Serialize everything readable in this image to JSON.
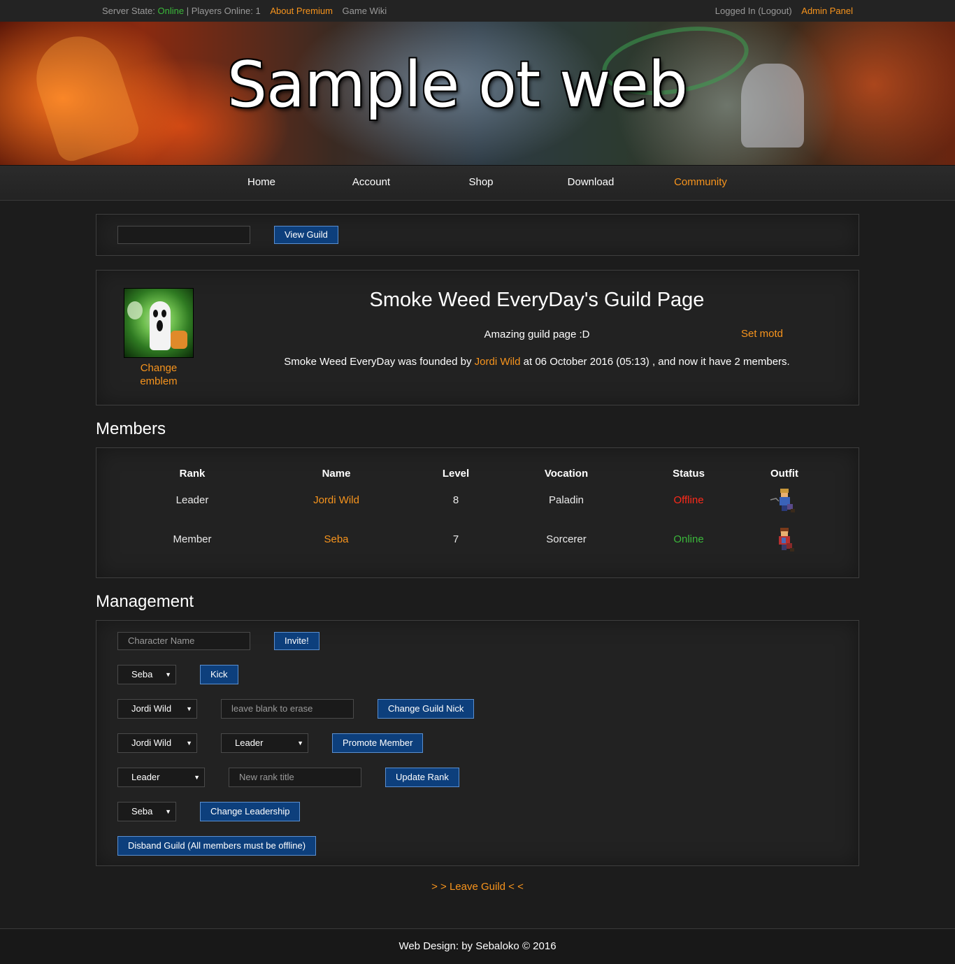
{
  "topbar": {
    "server_state_label": "Server State:",
    "server_state_value": "Online",
    "players_online": "| Players Online: 1",
    "about_premium": "About Premium",
    "game_wiki": "Game Wiki",
    "logged_in": "Logged In (Logout)",
    "admin_panel": "Admin Panel"
  },
  "banner": {
    "title": "Sample ot web"
  },
  "nav": {
    "items": [
      {
        "label": "Home"
      },
      {
        "label": "Account"
      },
      {
        "label": "Shop"
      },
      {
        "label": "Download"
      },
      {
        "label": "Community"
      }
    ],
    "active": "Community"
  },
  "view_guild": {
    "input_value": "",
    "button": "View Guild"
  },
  "guild": {
    "title": "Smoke Weed EveryDay's Guild Page",
    "change_emblem": "Change emblem",
    "motd": "Amazing guild page :D",
    "set_motd": "Set motd",
    "founded_prefix": "Smoke Weed EveryDay was founded by ",
    "founder": "Jordi Wild",
    "founded_suffix": " at 06 October 2016 (05:13) , and now it have 2 members."
  },
  "members": {
    "title": "Members",
    "headers": [
      "Rank",
      "Name",
      "Level",
      "Vocation",
      "Status",
      "Outfit"
    ],
    "rows": [
      {
        "rank": "Leader",
        "name": "Jordi Wild",
        "level": "8",
        "vocation": "Paladin",
        "status": "Offline"
      },
      {
        "rank": "Member",
        "name": "Seba",
        "level": "7",
        "vocation": "Sorcerer",
        "status": "Online"
      }
    ]
  },
  "management": {
    "title": "Management",
    "invite": {
      "placeholder": "Character Name",
      "button": "Invite!"
    },
    "kick": {
      "select": "Seba",
      "button": "Kick"
    },
    "nick": {
      "select": "Jordi Wild",
      "placeholder": "leave blank to erase",
      "button": "Change Guild Nick"
    },
    "promote": {
      "select_member": "Jordi Wild",
      "select_rank": "Leader",
      "button": "Promote Member"
    },
    "rank": {
      "select": "Leader",
      "placeholder": "New rank title",
      "button": "Update Rank"
    },
    "leadership": {
      "select": "Seba",
      "button": "Change Leadership"
    },
    "disband": {
      "button": "Disband Guild (All members must be offline)"
    }
  },
  "leave_guild": "> > Leave Guild < <",
  "footer": "Web Design: by Sebaloko © 2016",
  "colors": {
    "accent": "#f7941d",
    "online": "#3bb83b",
    "offline": "#ff2a1a",
    "button": "#0d3f7c"
  }
}
